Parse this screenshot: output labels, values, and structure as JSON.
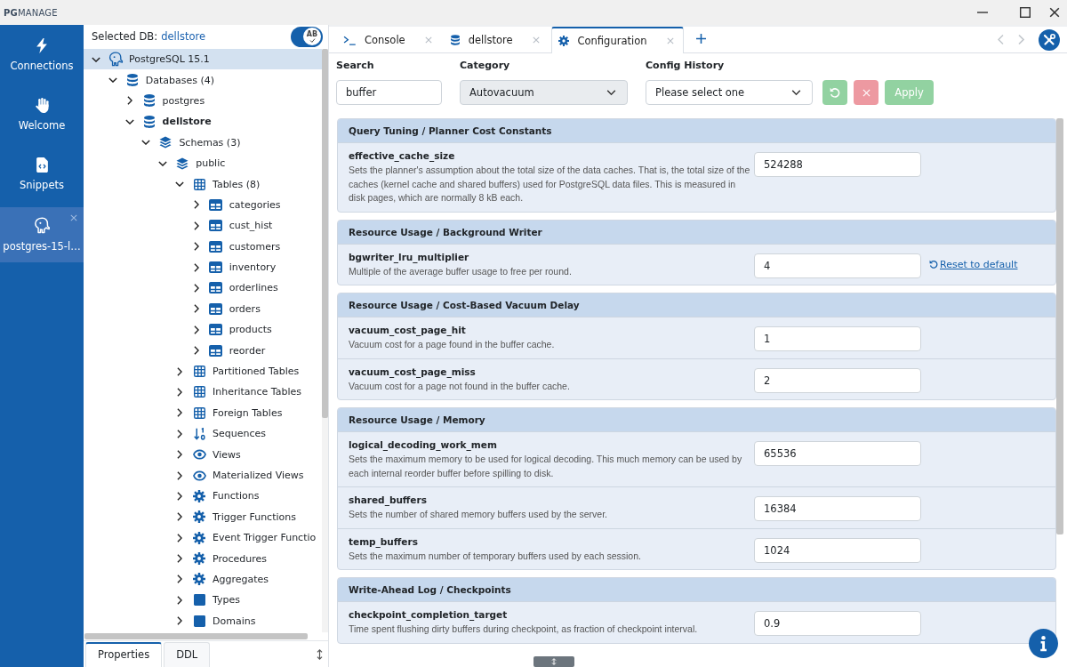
{
  "app": {
    "title": "**PG**MANAGE"
  },
  "nav": [
    {
      "kind": "connections",
      "label": "Connections",
      "selected": false
    },
    {
      "kind": "welcome",
      "label": "Welcome",
      "selected": false
    },
    {
      "kind": "snippets",
      "label": "Snippets",
      "selected": false
    },
    {
      "kind": "connection",
      "label": "postgres-15-l…",
      "selected": true
    }
  ],
  "tree_panel": {
    "selected_db_label": "Selected DB:",
    "selected_db": "dellstore",
    "toggle": {
      "on": true,
      "label": "AB"
    },
    "tree": [
      {
        "kind": "server",
        "label": "PostgreSQL 15.1",
        "expanded": true,
        "selected": true,
        "children": [
          {
            "kind": "databases",
            "label": "Databases (4)",
            "expanded": true,
            "selected": false,
            "children": [
              {
                "kind": "database",
                "label": "postgres",
                "expanded": false,
                "selected": false,
                "active": false
              },
              {
                "kind": "database",
                "label": "dellstore",
                "expanded": true,
                "selected": false,
                "active": true,
                "children": [
                  {
                    "kind": "schemas",
                    "label": "Schemas (3)",
                    "expanded": true,
                    "selected": false,
                    "children": [
                      {
                        "kind": "schema",
                        "label": "public",
                        "expanded": true,
                        "selected": false,
                        "children": [
                          {
                            "kind": "table_group",
                            "label": "Tables (8)",
                            "expanded": true,
                            "selected": false,
                            "children": [
                              {
                                "kind": "table",
                                "label": "categories",
                                "expanded": false,
                                "selected": false
                              },
                              {
                                "kind": "table",
                                "label": "cust_hist",
                                "expanded": false,
                                "selected": false
                              },
                              {
                                "kind": "table",
                                "label": "customers",
                                "expanded": false,
                                "selected": false
                              },
                              {
                                "kind": "table",
                                "label": "inventory",
                                "expanded": false,
                                "selected": false
                              },
                              {
                                "kind": "table",
                                "label": "orderlines",
                                "expanded": false,
                                "selected": false
                              },
                              {
                                "kind": "table",
                                "label": "orders",
                                "expanded": false,
                                "selected": false
                              },
                              {
                                "kind": "table",
                                "label": "products",
                                "expanded": false,
                                "selected": false
                              },
                              {
                                "kind": "table",
                                "label": "reorder",
                                "expanded": false,
                                "selected": false
                              }
                            ]
                          },
                          {
                            "kind": "table_group",
                            "label": "Partitioned Tables",
                            "expanded": false,
                            "selected": false
                          },
                          {
                            "kind": "table_group",
                            "label": "Inheritance Tables",
                            "expanded": false,
                            "selected": false
                          },
                          {
                            "kind": "table_group",
                            "label": "Foreign Tables",
                            "expanded": false,
                            "selected": false
                          },
                          {
                            "kind": "sequences",
                            "label": "Sequences",
                            "expanded": false,
                            "selected": false
                          },
                          {
                            "kind": "views",
                            "label": "Views",
                            "expanded": false,
                            "selected": false
                          },
                          {
                            "kind": "views",
                            "label": "Materialized Views",
                            "expanded": false,
                            "selected": false
                          },
                          {
                            "kind": "functions",
                            "label": "Functions",
                            "expanded": false,
                            "selected": false
                          },
                          {
                            "kind": "functions",
                            "label": "Trigger Functions",
                            "expanded": false,
                            "selected": false
                          },
                          {
                            "kind": "functions",
                            "label": "Event Trigger Functio",
                            "expanded": false,
                            "selected": false
                          },
                          {
                            "kind": "functions",
                            "label": "Procedures",
                            "expanded": false,
                            "selected": false
                          },
                          {
                            "kind": "functions",
                            "label": "Aggregates",
                            "expanded": false,
                            "selected": false
                          },
                          {
                            "kind": "types",
                            "label": "Types",
                            "expanded": false,
                            "selected": false
                          },
                          {
                            "kind": "types",
                            "label": "Domains",
                            "expanded": false,
                            "selected": false
                          }
                        ]
                      }
                    ]
                  }
                ]
              }
            ]
          }
        ]
      }
    ],
    "tabs": [
      {
        "label": "Properties",
        "selected": true
      },
      {
        "label": "DDL",
        "selected": false
      }
    ]
  },
  "tabs": [
    {
      "kind": "console",
      "label": "Console",
      "selected": false
    },
    {
      "kind": "database",
      "label": "dellstore",
      "selected": false
    },
    {
      "kind": "settings",
      "label": "Configuration",
      "selected": true
    }
  ],
  "filters": {
    "search": {
      "label": "Search",
      "value": "buffer",
      "disabled": false
    },
    "category": {
      "label": "Category",
      "value": "Autovacuum",
      "disabled": true
    },
    "config_history": {
      "label": "Config History",
      "value": "Please select one",
      "disabled": false
    },
    "buttons": [
      {
        "kind": "revert",
        "disabled": true
      },
      {
        "kind": "discard",
        "disabled": true
      },
      {
        "kind": "apply",
        "label": "Apply",
        "disabled": true
      }
    ]
  },
  "sections": [
    {
      "title": "Query Tuning / Planner Cost Constants",
      "settings": [
        {
          "name": "effective_cache_size",
          "description": "Sets the planner's assumption about the total size of the data caches. That is, the total size of the caches (kernel cache and shared buffers) used for PostgreSQL data files. This is measured in disk pages, which are normally 8 kB each.",
          "value": "524288"
        }
      ]
    },
    {
      "title": "Resource Usage / Background Writer",
      "settings": [
        {
          "name": "bgwriter_lru_multiplier",
          "description": "Multiple of the average buffer usage to free per round.",
          "value": "4",
          "reset_link": "Reset to default"
        }
      ]
    },
    {
      "title": "Resource Usage / Cost-Based Vacuum Delay",
      "settings": [
        {
          "name": "vacuum_cost_page_hit",
          "description": "Vacuum cost for a page found in the buffer cache.",
          "value": "1"
        },
        {
          "name": "vacuum_cost_page_miss",
          "description": "Vacuum cost for a page not found in the buffer cache.",
          "value": "2"
        }
      ]
    },
    {
      "title": "Resource Usage / Memory",
      "settings": [
        {
          "name": "logical_decoding_work_mem",
          "description": "Sets the maximum memory to be used for logical decoding. This much memory can be used by each internal reorder buffer before spilling to disk.",
          "value": "65536"
        },
        {
          "name": "shared_buffers",
          "description": "Sets the number of shared memory buffers used by the server.",
          "value": "16384"
        },
        {
          "name": "temp_buffers",
          "description": "Sets the maximum number of temporary buffers used by each session.",
          "value": "1024"
        }
      ]
    },
    {
      "title": "Write-Ahead Log / Checkpoints",
      "settings": [
        {
          "name": "checkpoint_completion_target",
          "description": "Time spent flushing dirty buffers during checkpoint, as fraction of checkpoint interval.",
          "value": "0.9"
        }
      ]
    }
  ]
}
